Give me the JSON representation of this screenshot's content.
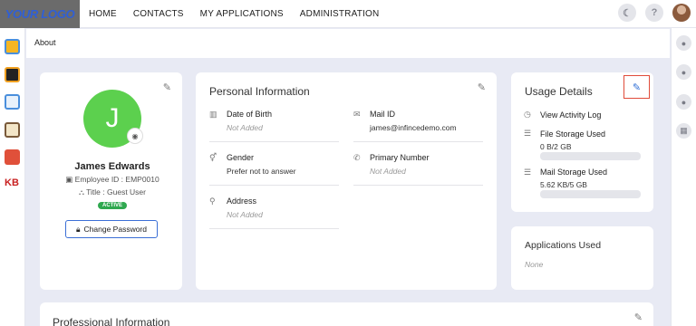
{
  "header": {
    "logo": "YOUR LOGO",
    "nav": [
      "HOME",
      "CONTACTS",
      "MY APPLICATIONS",
      "ADMINISTRATION"
    ],
    "icons": [
      "moon-icon",
      "help-icon",
      "user-avatar"
    ]
  },
  "left_apps": [
    {
      "name": "app-icon-1",
      "color": "#f5b622"
    },
    {
      "name": "app-icon-2",
      "color": "#222222"
    },
    {
      "name": "app-icon-3",
      "color": "#4a8fdc"
    },
    {
      "name": "app-icon-4",
      "color": "#7a5a3a"
    },
    {
      "name": "app-icon-5",
      "color": "#e0503a"
    }
  ],
  "left_kb": "KB",
  "breadcrumb": "About",
  "profile": {
    "initial": "J",
    "name": "James Edwards",
    "employee_id": "Employee ID : EMP0010",
    "title": "Title : Guest User",
    "status": "ACTIVE",
    "change_password": "Change Password"
  },
  "personal": {
    "title": "Personal Information",
    "dob_label": "Date of Birth",
    "dob_value": "Not Added",
    "mail_label": "Mail ID",
    "mail_value": "james@infincedemo.com",
    "gender_label": "Gender",
    "gender_value": "Prefer not to answer",
    "phone_label": "Primary Number",
    "phone_value": "Not Added",
    "address_label": "Address",
    "address_value": "Not Added"
  },
  "usage": {
    "title": "Usage Details",
    "activity": "View Activity Log",
    "file_label": "File Storage Used",
    "file_value": "0 B/2 GB",
    "mail_label": "Mail Storage Used",
    "mail_value": "5.62 KB/5 GB"
  },
  "apps_used": {
    "title": "Applications Used",
    "value": "None"
  },
  "professional": {
    "title": "Professional Information"
  },
  "colors": {
    "accent": "#2f6fd6",
    "active": "#2fa84f",
    "avatar": "#5cd04e",
    "highlight": "#e04b3a"
  }
}
